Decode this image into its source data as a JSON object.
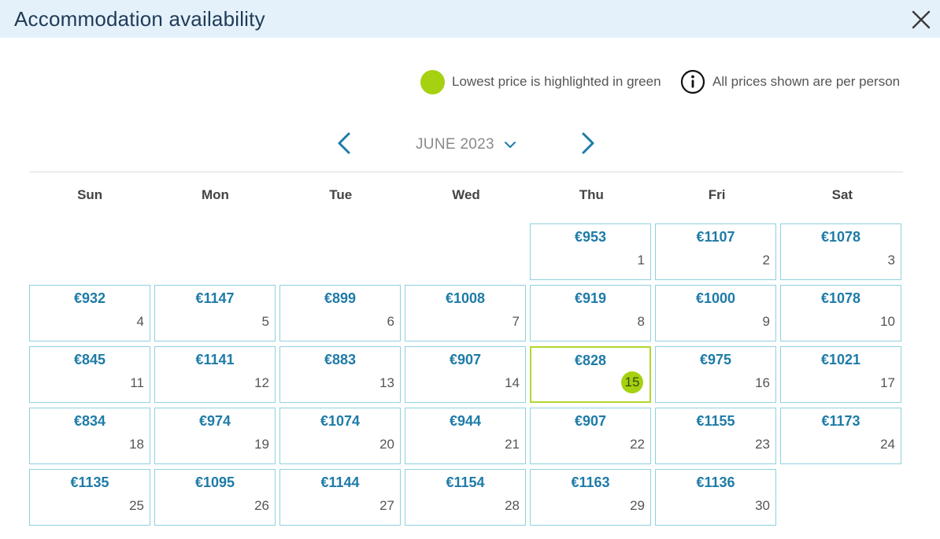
{
  "header": {
    "title": "Accommodation availability",
    "close_icon": "close-icon"
  },
  "legend": {
    "lowest_text": "Lowest price is highlighted in green",
    "info_text": "All prices shown are per person",
    "lowest_color": "#a5d110"
  },
  "nav": {
    "month_label": "JUNE 2023",
    "prev_icon": "chevron-left-icon",
    "next_icon": "chevron-right-icon"
  },
  "weekdays": [
    "Sun",
    "Mon",
    "Tue",
    "Wed",
    "Thu",
    "Fri",
    "Sat"
  ],
  "leading_blank_days": 4,
  "days": [
    {
      "day": "1",
      "price": "€953"
    },
    {
      "day": "2",
      "price": "€1107"
    },
    {
      "day": "3",
      "price": "€1078"
    },
    {
      "day": "4",
      "price": "€932"
    },
    {
      "day": "5",
      "price": "€1147"
    },
    {
      "day": "6",
      "price": "€899"
    },
    {
      "day": "7",
      "price": "€1008"
    },
    {
      "day": "8",
      "price": "€919"
    },
    {
      "day": "9",
      "price": "€1000"
    },
    {
      "day": "10",
      "price": "€1078"
    },
    {
      "day": "11",
      "price": "€845"
    },
    {
      "day": "12",
      "price": "€1141"
    },
    {
      "day": "13",
      "price": "€883"
    },
    {
      "day": "14",
      "price": "€907"
    },
    {
      "day": "15",
      "price": "€828",
      "lowest": true
    },
    {
      "day": "16",
      "price": "€975"
    },
    {
      "day": "17",
      "price": "€1021"
    },
    {
      "day": "18",
      "price": "€834"
    },
    {
      "day": "19",
      "price": "€974"
    },
    {
      "day": "20",
      "price": "€1074"
    },
    {
      "day": "21",
      "price": "€944"
    },
    {
      "day": "22",
      "price": "€907"
    },
    {
      "day": "23",
      "price": "€1155"
    },
    {
      "day": "24",
      "price": "€1173"
    },
    {
      "day": "25",
      "price": "€1135"
    },
    {
      "day": "26",
      "price": "€1095"
    },
    {
      "day": "27",
      "price": "€1144"
    },
    {
      "day": "28",
      "price": "€1154"
    },
    {
      "day": "29",
      "price": "€1163"
    },
    {
      "day": "30",
      "price": "€1136"
    }
  ]
}
